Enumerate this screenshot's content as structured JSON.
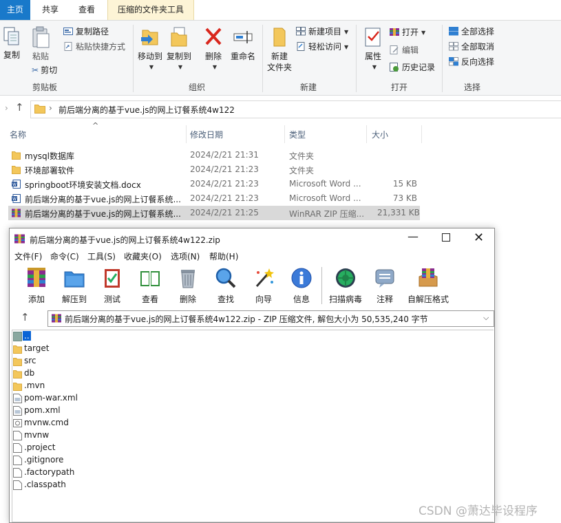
{
  "explorer": {
    "tabs": [
      {
        "label": "主页"
      },
      {
        "label": "共享"
      },
      {
        "label": "查看"
      },
      {
        "label": "压缩的文件夹工具"
      }
    ],
    "ribbon": {
      "clipboard": {
        "copy": "复制",
        "paste": "粘贴",
        "copy_path": "复制路径",
        "paste_shortcut": "粘贴快捷方式",
        "cut": "剪切",
        "group": "剪贴板"
      },
      "organize": {
        "move_to": "移动到",
        "copy_to": "复制到",
        "delete": "删除",
        "rename": "重命名",
        "group": "组织"
      },
      "new": {
        "new_folder_line1": "新建",
        "new_folder_line2": "文件夹",
        "new_item": "新建项目",
        "easy_access": "轻松访问",
        "group": "新建"
      },
      "open": {
        "properties": "属性",
        "open": "打开",
        "edit": "编辑",
        "history": "历史记录",
        "group": "打开"
      },
      "select": {
        "select_all": "全部选择",
        "select_none": "全部取消",
        "invert": "反向选择",
        "group": "选择"
      }
    },
    "address": {
      "path": "前后端分离的基于vue.js的网上订餐系统4w122"
    },
    "columns": {
      "name": "名称",
      "date": "修改日期",
      "type": "类型",
      "size": "大小"
    },
    "files": [
      {
        "name": "mysql数据库",
        "date": "2024/2/21 21:31",
        "type": "文件夹",
        "size": "",
        "icon": "folder-icon"
      },
      {
        "name": "环境部署软件",
        "date": "2024/2/21 21:23",
        "type": "文件夹",
        "size": "",
        "icon": "folder-icon"
      },
      {
        "name": "springboot环境安装文档.docx",
        "date": "2024/2/21 21:23",
        "type": "Microsoft Word ...",
        "size": "15 KB",
        "icon": "word-doc-icon"
      },
      {
        "name": "前后端分离的基于vue.js的网上订餐系统...",
        "date": "2024/2/21 21:23",
        "type": "Microsoft Word ...",
        "size": "73 KB",
        "icon": "word-doc-icon"
      },
      {
        "name": "前后端分离的基于vue.js的网上订餐系统...",
        "date": "2024/2/21 21:25",
        "type": "WinRAR ZIP 压缩...",
        "size": "21,331 KB",
        "icon": "winrar-zip-icon"
      }
    ]
  },
  "winrar": {
    "title": "前后端分离的基于vue.js的网上订餐系统4w122.zip",
    "menu": [
      "文件(F)",
      "命令(C)",
      "工具(S)",
      "收藏夹(O)",
      "选项(N)",
      "帮助(H)"
    ],
    "toolbar": [
      {
        "label": "添加",
        "icon": "add-archive-icon"
      },
      {
        "label": "解压到",
        "icon": "extract-to-icon"
      },
      {
        "label": "测试",
        "icon": "test-icon"
      },
      {
        "label": "查看",
        "icon": "view-icon"
      },
      {
        "label": "删除",
        "icon": "trash-icon"
      },
      {
        "label": "查找",
        "icon": "find-icon"
      },
      {
        "label": "向导",
        "icon": "wizard-icon"
      },
      {
        "label": "信息",
        "icon": "info-icon"
      },
      {
        "label": "扫描病毒",
        "icon": "virus-scan-icon"
      },
      {
        "label": "注释",
        "icon": "comment-icon"
      },
      {
        "label": "自解压格式",
        "icon": "sfx-icon"
      }
    ],
    "address": "前后端分离的基于vue.js的网上订餐系统4w122.zip - ZIP 压缩文件, 解包大小为 50,535,240 字节",
    "items": [
      {
        "name": "..",
        "icon": "parent-folder-icon"
      },
      {
        "name": "target",
        "icon": "folder-icon"
      },
      {
        "name": "src",
        "icon": "folder-icon"
      },
      {
        "name": "db",
        "icon": "folder-icon"
      },
      {
        "name": ".mvn",
        "icon": "folder-icon"
      },
      {
        "name": "pom-war.xml",
        "icon": "xml-file-icon"
      },
      {
        "name": "pom.xml",
        "icon": "xml-file-icon"
      },
      {
        "name": "mvnw.cmd",
        "icon": "cmd-file-icon"
      },
      {
        "name": "mvnw",
        "icon": "file-icon"
      },
      {
        "name": ".project",
        "icon": "file-icon"
      },
      {
        "name": ".gitignore",
        "icon": "file-icon"
      },
      {
        "name": ".factorypath",
        "icon": "file-icon"
      },
      {
        "name": ".classpath",
        "icon": "file-icon"
      }
    ]
  },
  "watermark": "CSDN @萧达毕设程序"
}
